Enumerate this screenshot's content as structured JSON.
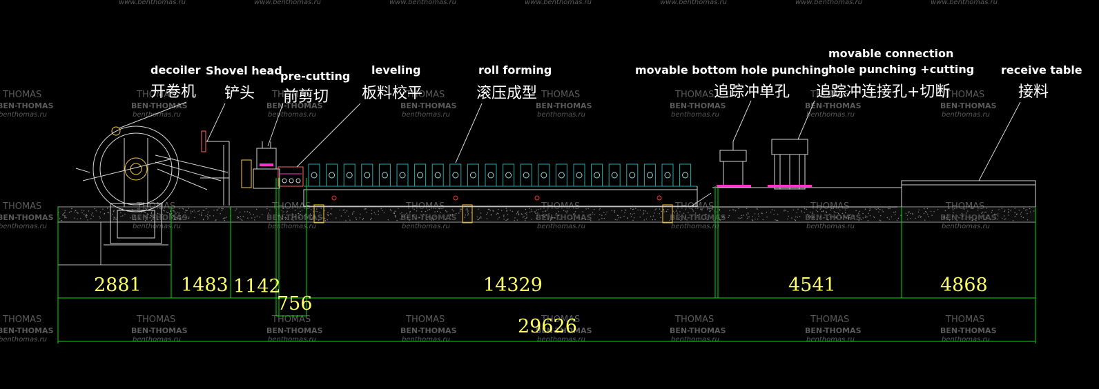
{
  "watermark": {
    "url": "www.benthomas.ru",
    "word": "THOMAS",
    "brand": "BEN-THOMAS",
    "small_url": "benthomas.ru"
  },
  "labels": {
    "decoiler": {
      "en": "decoiler",
      "cn": "开卷机"
    },
    "shovel_head": {
      "en": "Shovel head",
      "cn": "铲头"
    },
    "pre_cutting": {
      "en": "pre-cutting",
      "cn": "前剪切"
    },
    "leveling": {
      "en": "leveling",
      "cn": "板料校平"
    },
    "roll_forming": {
      "en": "roll forming",
      "cn": "滚压成型"
    },
    "bottom_punch": {
      "en": "movable bottom hole punching",
      "cn": "追踪冲单孔"
    },
    "connection_punch": {
      "en_line1": "movable connection",
      "en_line2": "hole punching +cutting",
      "cn": "追踪冲连接孔+切断"
    },
    "receive_table": {
      "en": "receive table",
      "cn": "接料"
    }
  },
  "dimensions": {
    "decoiler": "2881",
    "shovel_head": "1483",
    "pre_cutting": "1142",
    "leveling": "756",
    "roll_forming": "14329",
    "punching": "4541",
    "receive_table": "4868",
    "total": "29626"
  },
  "colors": {
    "dimension_line": "#00dd00",
    "dimension_text": "#ffff66",
    "machine": "#d8d8d8",
    "roller": "#2aa8a8",
    "accent": "#ff33cc",
    "marker": "#ff3333",
    "label": "#ffffff"
  }
}
